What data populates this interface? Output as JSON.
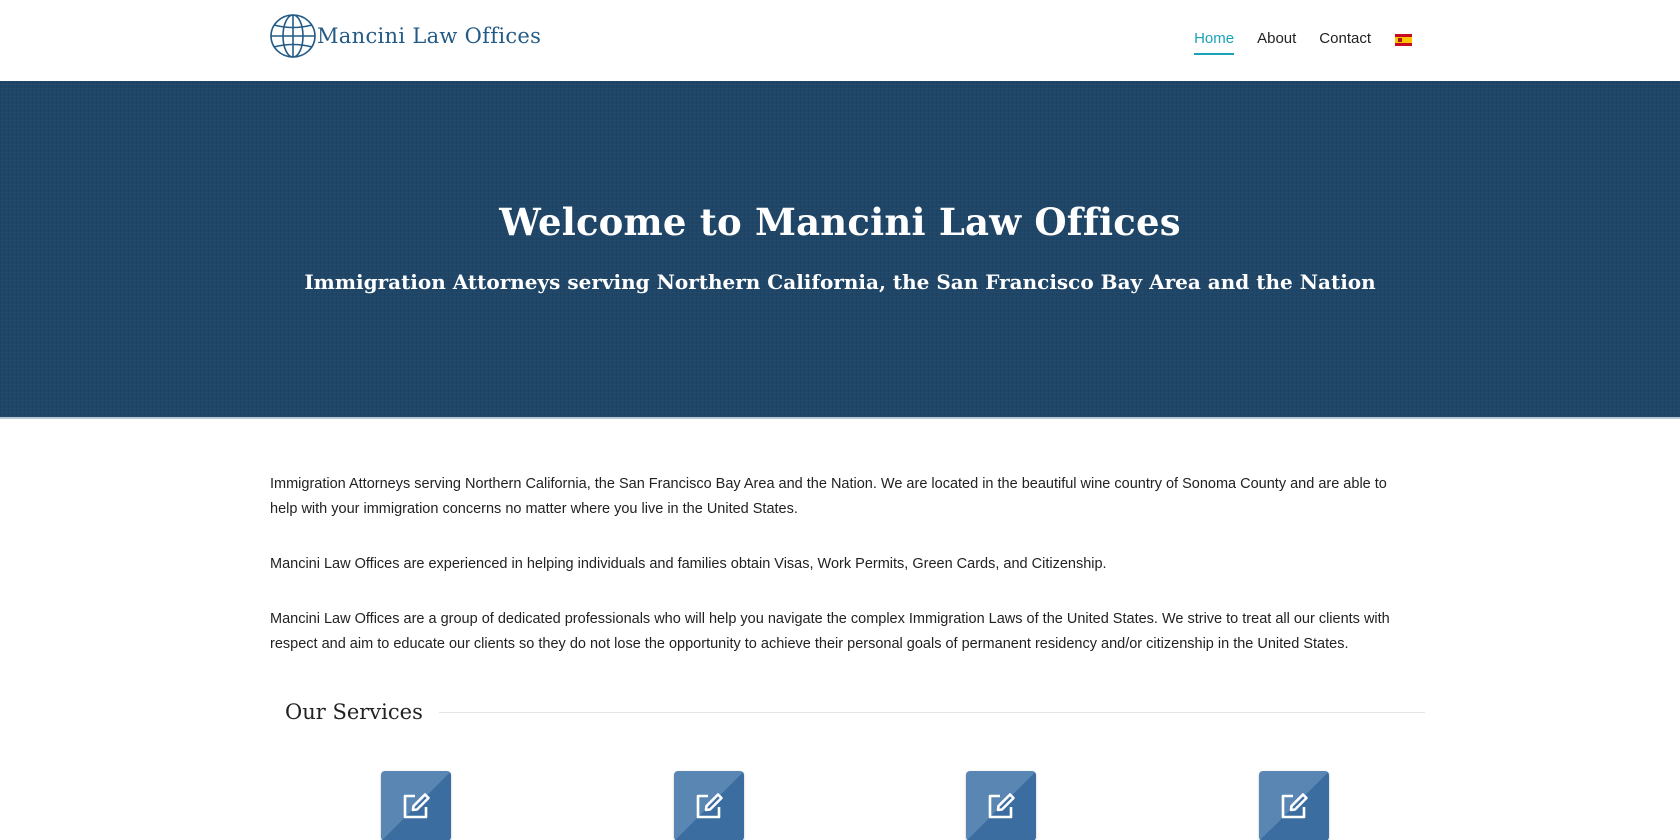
{
  "header": {
    "logo_text": "Mancini Law Offices",
    "logo_icon": "globe-icon",
    "nav": [
      {
        "label": "Home",
        "active": true
      },
      {
        "label": "About",
        "active": false
      },
      {
        "label": "Contact",
        "active": false
      }
    ],
    "language_icon": "spain-flag-icon"
  },
  "hero": {
    "title": "Welcome to Mancini Law Offices",
    "subtitle": "Immigration Attorneys serving Northern California, the San Francisco Bay Area and the Nation"
  },
  "main": {
    "paragraphs": [
      "Immigration Attorneys serving Northern California, the San Francisco Bay Area and the Nation. We are located in the beautiful wine country of Sonoma County and are able to help with your immigration concerns no matter where you live in the United States.",
      "Mancini Law Offices are experienced in helping individuals and families obtain Visas, Work Permits, Green Cards, and Citizenship.",
      "Mancini Law Offices are a group of dedicated professionals who will help you navigate the complex Immigration Laws of the United States. We strive to treat all our clients with respect and aim to educate our clients so they do not lose the opportunity to achieve their personal goals of permanent residency and/or citizenship in the United States."
    ],
    "services_title": "Our Services",
    "service_icons": [
      "edit-icon",
      "edit-icon",
      "edit-icon",
      "edit-icon"
    ]
  },
  "colors": {
    "brand": "#245b86",
    "accent": "#1aa3b8",
    "hero_bg": "#1f4567",
    "icon_bg": "#3b6da0"
  }
}
